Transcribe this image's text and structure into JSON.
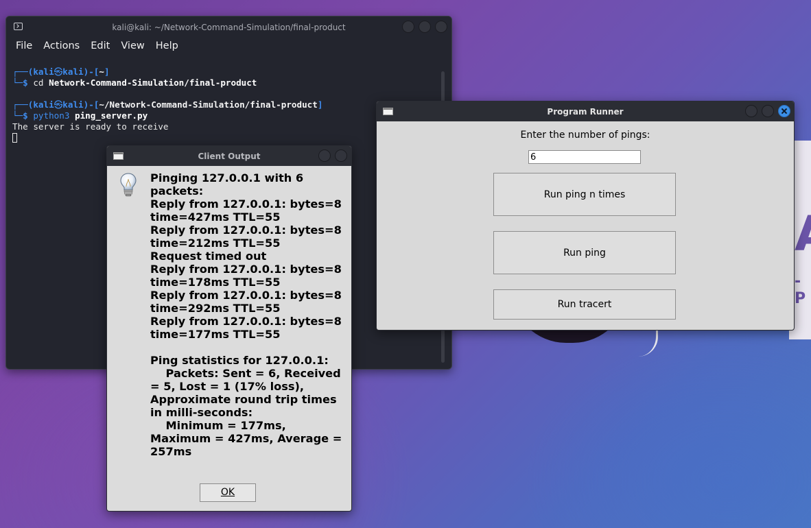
{
  "terminal": {
    "title": "kali@kali: ~/Network-Command-Simulation/final-product",
    "menu": [
      "File",
      "Actions",
      "Edit",
      "View",
      "Help"
    ],
    "prompt1": {
      "user": "kali",
      "host": "kali",
      "cwd": "~",
      "command": "cd",
      "arg": "Network-Command-Simulation/final-product"
    },
    "prompt2": {
      "user": "kali",
      "host": "kali",
      "cwd": "~/Network-Command-Simulation/final-product",
      "command": "python3",
      "arg": "ping_server.py"
    },
    "output_line": "The server is ready to receive"
  },
  "client_output": {
    "title": "Client Output",
    "icon": "lightbulb-icon",
    "message": "Pinging 127.0.0.1 with 6 packets:\nReply from 127.0.0.1: bytes=8 time=427ms TTL=55\nReply from 127.0.0.1: bytes=8 time=212ms TTL=55\nRequest timed out\nReply from 127.0.0.1: bytes=8 time=178ms TTL=55\nReply from 127.0.0.1: bytes=8 time=292ms TTL=55\nReply from 127.0.0.1: bytes=8 time=177ms TTL=55\n\nPing statistics for 127.0.0.1:\n    Packets: Sent = 6, Received = 5, Lost = 1 (17% loss),\nApproximate round trip times in milli-seconds:\n    Minimum = 177ms, Maximum = 427ms, Average = 257ms",
    "ok_label": "OK"
  },
  "runner": {
    "title": "Program Runner",
    "prompt": "Enter the number of pings:",
    "pings_value": "6",
    "buttons": {
      "run_n": "Run ping n times",
      "run_ping": "Run ping",
      "run_tracert": "Run tracert"
    }
  },
  "colors": {
    "accent_blue": "#3f8df0",
    "terminal_bg": "#23252e",
    "dialog_bg": "#dcdcdc"
  }
}
